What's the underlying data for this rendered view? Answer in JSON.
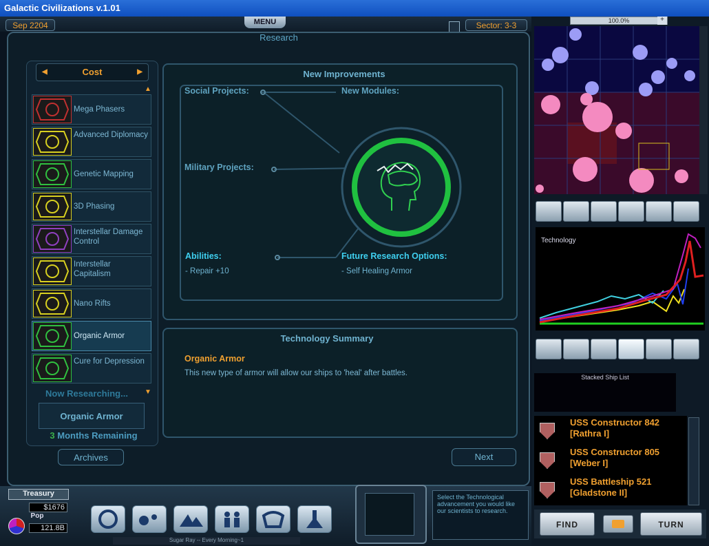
{
  "window": {
    "title": "Galactic Civilizations v.1.01"
  },
  "topbar": {
    "date": "Sep 2204",
    "menu": "MENU",
    "sector": "Sector: 3-3"
  },
  "research": {
    "title": "Research",
    "sort_label": "Cost",
    "techs": [
      {
        "name": "Mega Phasers",
        "icon": "phaser-icon",
        "color": "#c03030"
      },
      {
        "name": "Advanced Diplomacy",
        "icon": "diplomacy-icon",
        "color": "#d8d020"
      },
      {
        "name": "Genetic Mapping",
        "icon": "head-icon",
        "color": "#30c040"
      },
      {
        "name": "3D Phasing",
        "icon": "diplomacy-icon",
        "color": "#d8d020"
      },
      {
        "name": "Interstellar Damage Control",
        "icon": "triangle-icon",
        "color": "#9040c0"
      },
      {
        "name": "Interstellar Capitalism",
        "icon": "diplomacy-icon",
        "color": "#d8d020"
      },
      {
        "name": "Nano Rifts",
        "icon": "diplomacy-icon",
        "color": "#d8d020"
      },
      {
        "name": "Organic Armor",
        "icon": "head-icon",
        "color": "#30c040",
        "selected": true
      },
      {
        "name": "Cure for Depression",
        "icon": "head-icon",
        "color": "#30c040"
      }
    ],
    "now_researching_label": "Now Researching...",
    "current": "Organic Armor",
    "months": "3",
    "months_label": "Months Remaining",
    "archives": "Archives",
    "next": "Next"
  },
  "improvements": {
    "title": "New Improvements",
    "social": "Social Projects:",
    "modules": "New Modules:",
    "military": "Military Projects:",
    "abilities": "Abilities:",
    "ability_items": [
      "- Repair +10"
    ],
    "future": "Future Research Options:",
    "future_items": [
      "- Self Healing Armor"
    ]
  },
  "summary": {
    "title": "Technology Summary",
    "name": "Organic Armor",
    "desc": "This new type of armor will allow our ships to 'heal' after battles."
  },
  "right": {
    "zoom": "100.0%",
    "graph_label": "Technology",
    "stacked_label": "Stacked Ship List",
    "ships": [
      {
        "name": "USS Constructor 842",
        "loc": "[Rathra I]"
      },
      {
        "name": "USS Constructor 805",
        "loc": "[Weber I]"
      },
      {
        "name": "USS Battleship 521",
        "loc": "[Gladstone II]"
      }
    ],
    "find": "FIND",
    "turn": "TURN"
  },
  "bottom": {
    "treasury_label": "Treasury",
    "treasury": "$1676",
    "pop_label": "Pop",
    "pop": "121.8B",
    "music": "Sugar Ray -- Every Morning~1",
    "advisor": "Select the Technological advancement you would like our scientists to research."
  }
}
